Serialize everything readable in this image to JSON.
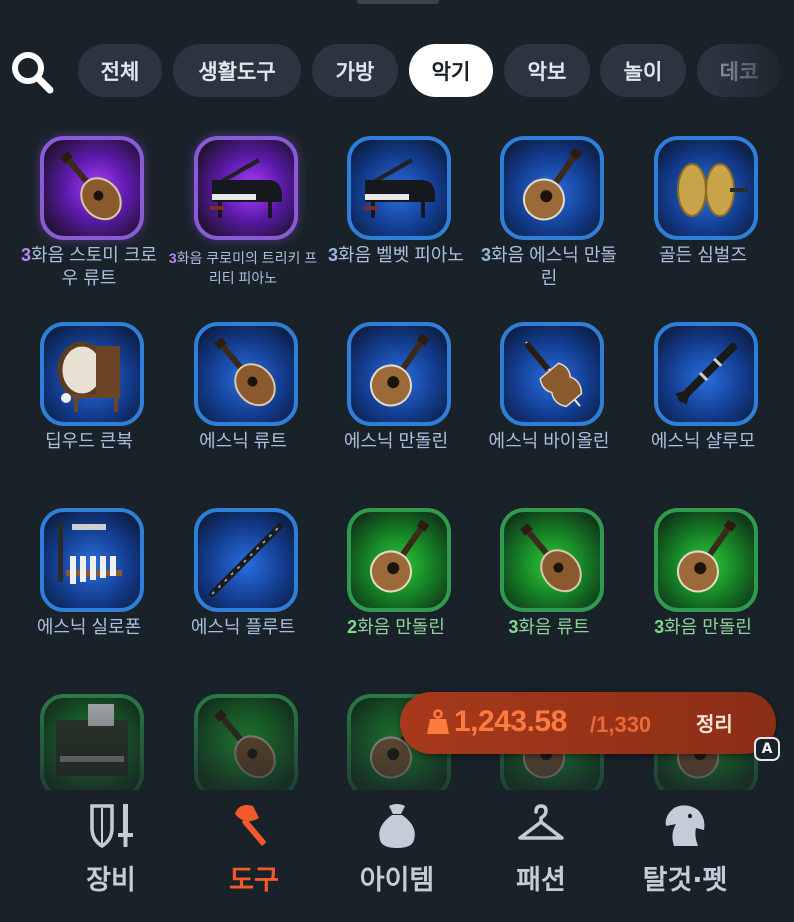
{
  "filters": {
    "search_icon": "search-icon",
    "chips": [
      {
        "label": "전체"
      },
      {
        "label": "생활도구"
      },
      {
        "label": "가방"
      },
      {
        "label": "악기"
      },
      {
        "label": "악보"
      },
      {
        "label": "놀이"
      },
      {
        "label": "데코"
      }
    ],
    "active": "악기"
  },
  "items": [
    {
      "tier": "3",
      "label": "화음 스토미 크로우 류트",
      "rarity": "purple",
      "icon": "lute-icon"
    },
    {
      "tier": "3",
      "label": "화음 쿠로미의 트리키 프리티 피아노",
      "rarity": "purple",
      "icon": "grand-piano-icon"
    },
    {
      "tier": "3",
      "label": "화음 벨벳 피아노",
      "rarity": "blue",
      "icon": "grand-piano-icon"
    },
    {
      "tier": "3",
      "label": "화음 에스닉 만돌린",
      "rarity": "blue",
      "icon": "mandolin-icon"
    },
    {
      "tier": "",
      "label": "골든 심벌즈",
      "rarity": "blue",
      "icon": "cymbals-icon"
    },
    {
      "tier": "",
      "label": "딥우드 큰북",
      "rarity": "blue",
      "icon": "drum-icon"
    },
    {
      "tier": "",
      "label": "에스닉 류트",
      "rarity": "blue",
      "icon": "lute-icon"
    },
    {
      "tier": "",
      "label": "에스닉 만돌린",
      "rarity": "blue",
      "icon": "mandolin-icon"
    },
    {
      "tier": "",
      "label": "에스닉 바이올린",
      "rarity": "blue",
      "icon": "violin-icon"
    },
    {
      "tier": "",
      "label": "에스닉 샬루모",
      "rarity": "blue",
      "icon": "clarinet-icon"
    },
    {
      "tier": "",
      "label": "에스닉 실로폰",
      "rarity": "blue",
      "icon": "xylophone-icon"
    },
    {
      "tier": "",
      "label": "에스닉 플루트",
      "rarity": "blue",
      "icon": "flute-icon"
    },
    {
      "tier": "2",
      "label": "화음 만돌린",
      "rarity": "green",
      "icon": "mandolin-icon"
    },
    {
      "tier": "3",
      "label": "화음 류트",
      "rarity": "green",
      "icon": "lute-icon"
    },
    {
      "tier": "3",
      "label": "화음 만돌린",
      "rarity": "green",
      "icon": "mandolin-icon"
    },
    {
      "tier": "",
      "label": "",
      "rarity": "green",
      "icon": "organ-icon"
    },
    {
      "tier": "",
      "label": "",
      "rarity": "green",
      "icon": "lute-icon"
    },
    {
      "tier": "",
      "label": "",
      "rarity": "green",
      "icon": "mandolin-icon"
    },
    {
      "tier": "",
      "label": "",
      "rarity": "green",
      "icon": "mandolin-icon"
    },
    {
      "tier": "",
      "label": "",
      "rarity": "green",
      "icon": "mandolin-icon"
    }
  ],
  "weight": {
    "icon": "weight-icon",
    "current": "1,243.58",
    "max": "/1,330",
    "sort_label": "정리",
    "shortcut": "A"
  },
  "nav": {
    "active": "도구",
    "items": [
      {
        "label": "장비",
        "icon": "shield-sword-icon"
      },
      {
        "label": "도구",
        "icon": "axe-icon"
      },
      {
        "label": "아이템",
        "icon": "sack-icon"
      },
      {
        "label": "패션",
        "icon": "hanger-icon"
      },
      {
        "label": "탈것·펫",
        "icon": "horse-icon"
      }
    ]
  },
  "colors": {
    "background": "#1a2229",
    "active_nav": "#f15a2b",
    "weight_text": "#ff7a3e",
    "purple_rarity": "#8b5bd6",
    "blue_rarity": "#2f7fd8",
    "green_rarity": "#2f9b4f"
  }
}
